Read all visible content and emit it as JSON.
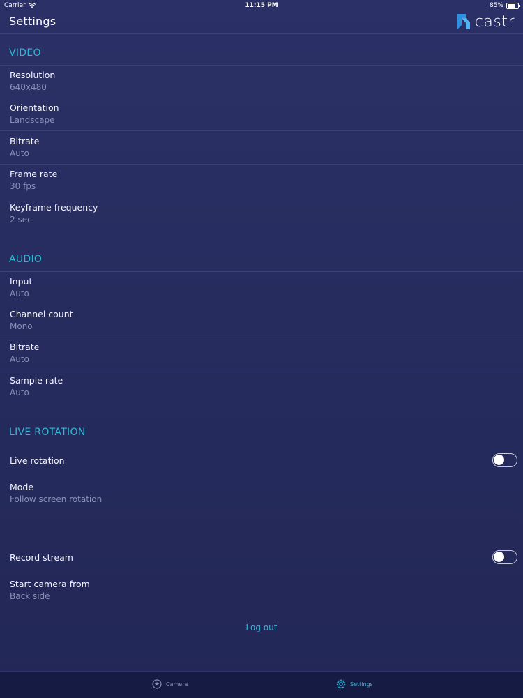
{
  "status_bar": {
    "carrier": "Carrier",
    "time": "11:15 PM",
    "battery": "85%",
    "battery_level": 0.85
  },
  "header": {
    "title": "Settings",
    "brand": "castr"
  },
  "sections": {
    "video": {
      "title": "VIDEO",
      "items": [
        {
          "label": "Resolution",
          "value": "640x480"
        },
        {
          "label": "Orientation",
          "value": "Landscape"
        },
        {
          "label": "Bitrate",
          "value": "Auto"
        },
        {
          "label": "Frame rate",
          "value": "30 fps"
        },
        {
          "label": "Keyframe frequency",
          "value": "2 sec"
        }
      ]
    },
    "audio": {
      "title": "AUDIO",
      "items": [
        {
          "label": "Input",
          "value": "Auto"
        },
        {
          "label": "Channel count",
          "value": "Mono"
        },
        {
          "label": "Bitrate",
          "value": "Auto"
        },
        {
          "label": "Sample rate",
          "value": "Auto"
        }
      ]
    },
    "live_rotation": {
      "title": "LIVE ROTATION",
      "toggle_label": "Live rotation",
      "toggle_on": false,
      "mode_label": "Mode",
      "mode_value": "Follow screen rotation"
    },
    "other": {
      "record_label": "Record stream",
      "record_on": false,
      "start_camera_label": "Start camera from",
      "start_camera_value": "Back side"
    }
  },
  "logout_label": "Log out",
  "tabs": {
    "camera": "Camera",
    "settings": "Settings",
    "active": "settings"
  },
  "colors": {
    "accent": "#31b8d6",
    "background": "#262c5e",
    "tab_bar": "#161b44"
  }
}
